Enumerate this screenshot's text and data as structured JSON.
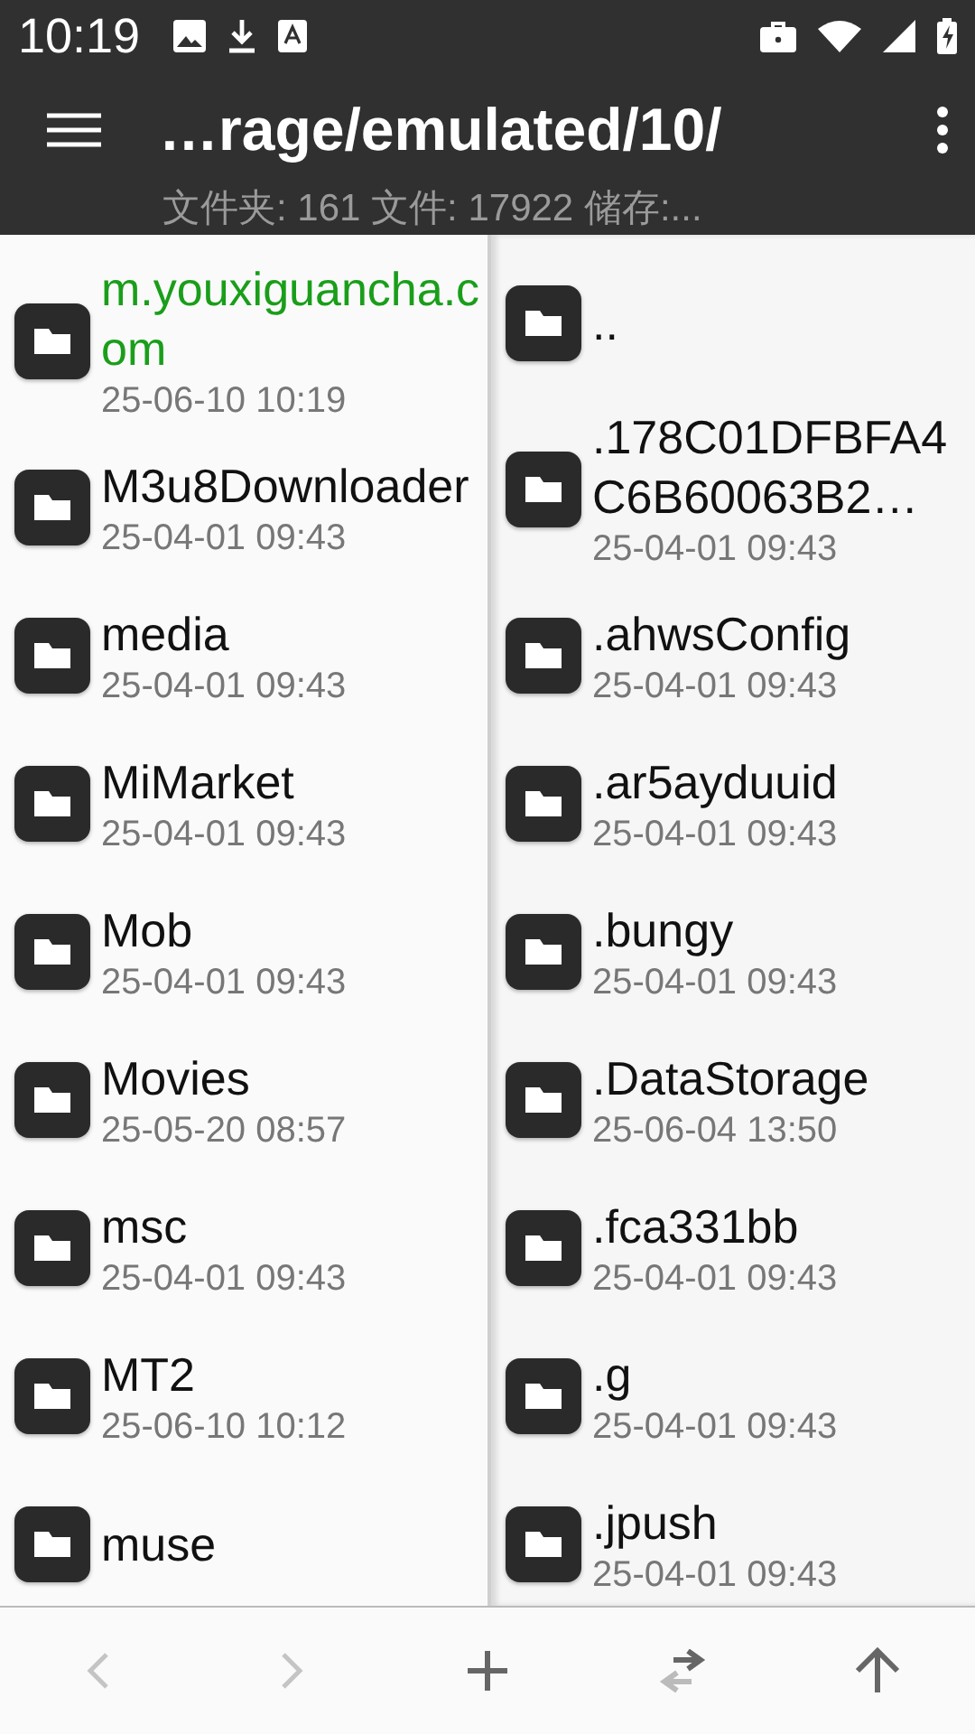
{
  "status_bar": {
    "time": "10:19"
  },
  "toolbar": {
    "title": "…rage/emulated/10/",
    "subtitle": "文件夹: 161  文件: 17922  储存:..."
  },
  "left_panel": {
    "items": [
      {
        "name": "m.youxiguancha.com",
        "date": "25-06-10 10:19",
        "color": "#1a9e1a"
      },
      {
        "name": "M3u8Downloader",
        "date": "25-04-01 09:43",
        "color": "#111111"
      },
      {
        "name": "media",
        "date": "25-04-01 09:43",
        "color": "#111111"
      },
      {
        "name": "MiMarket",
        "date": "25-04-01 09:43",
        "color": "#111111"
      },
      {
        "name": "Mob",
        "date": "25-04-01 09:43",
        "color": "#111111"
      },
      {
        "name": "Movies",
        "date": "25-05-20 08:57",
        "color": "#111111"
      },
      {
        "name": "msc",
        "date": "25-04-01 09:43",
        "color": "#111111"
      },
      {
        "name": "MT2",
        "date": "25-06-10 10:12",
        "color": "#111111"
      },
      {
        "name": "muse",
        "color": "#111111"
      }
    ]
  },
  "right_panel": {
    "items": [
      {
        "name": "..",
        "color": "#111111"
      },
      {
        "name": ".178C01DFBFA4C6B60063B2…",
        "date": "25-04-01 09:43",
        "color": "#111111"
      },
      {
        "name": ".ahwsConfig",
        "date": "25-04-01 09:43",
        "color": "#111111"
      },
      {
        "name": ".ar5ayduuid",
        "date": "25-04-01 09:43",
        "color": "#111111"
      },
      {
        "name": ".bungy",
        "date": "25-04-01 09:43",
        "color": "#111111"
      },
      {
        "name": ".DataStorage",
        "date": "25-06-04 13:50",
        "color": "#111111"
      },
      {
        "name": ".fca331bb",
        "date": "25-04-01 09:43",
        "color": "#111111"
      },
      {
        "name": ".g",
        "date": "25-04-01 09:43",
        "color": "#111111"
      },
      {
        "name": ".jpush",
        "date": "25-04-01 09:43",
        "color": "#111111"
      }
    ]
  },
  "bottom_bar": [
    {
      "kind": "back",
      "disabled": true
    },
    {
      "kind": "forward",
      "disabled": true
    },
    {
      "kind": "add",
      "disabled": false
    },
    {
      "kind": "swap",
      "disabled": false
    },
    {
      "kind": "up",
      "disabled": false
    }
  ]
}
